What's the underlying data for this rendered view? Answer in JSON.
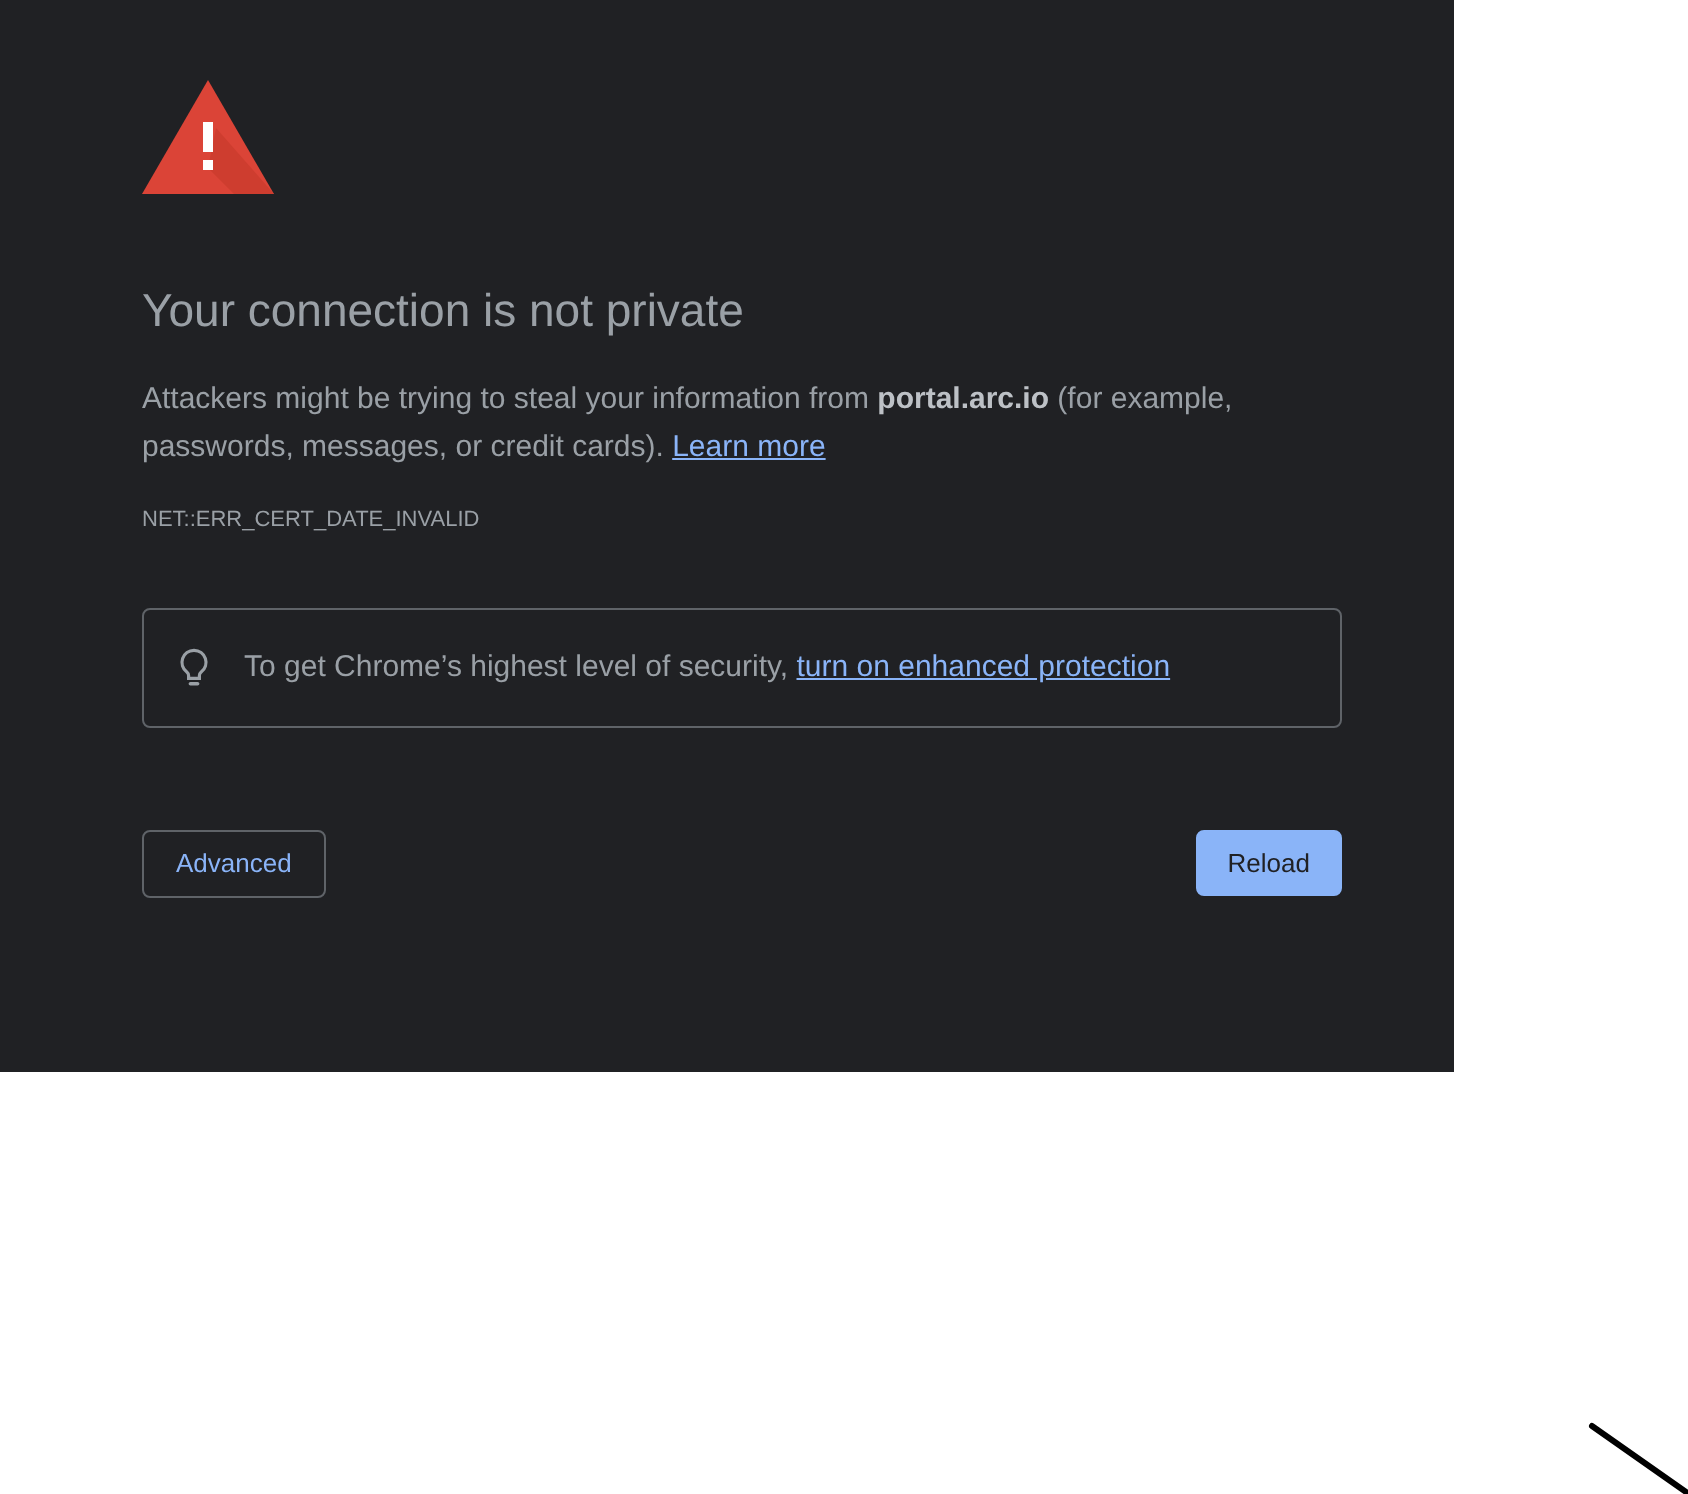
{
  "heading": "Your connection is not private",
  "message": "Attackers might be trying to steal your information from **portal.arc.io** (for example, passwords, messages, or credit cards).",
  "message_link": "Learn more",
  "error_code": "NET::ERR_CERT_DATE_INVALID",
  "enhanced_protection": {
    "text": "To get Chrome’s highest level of security,",
    "link": "turn on enhanced protection"
  },
  "buttons": [
    {
      "label": "Advanced",
      "kind": "outline"
    },
    {
      "label": "Reload",
      "kind": "primary"
    }
  ]
}
